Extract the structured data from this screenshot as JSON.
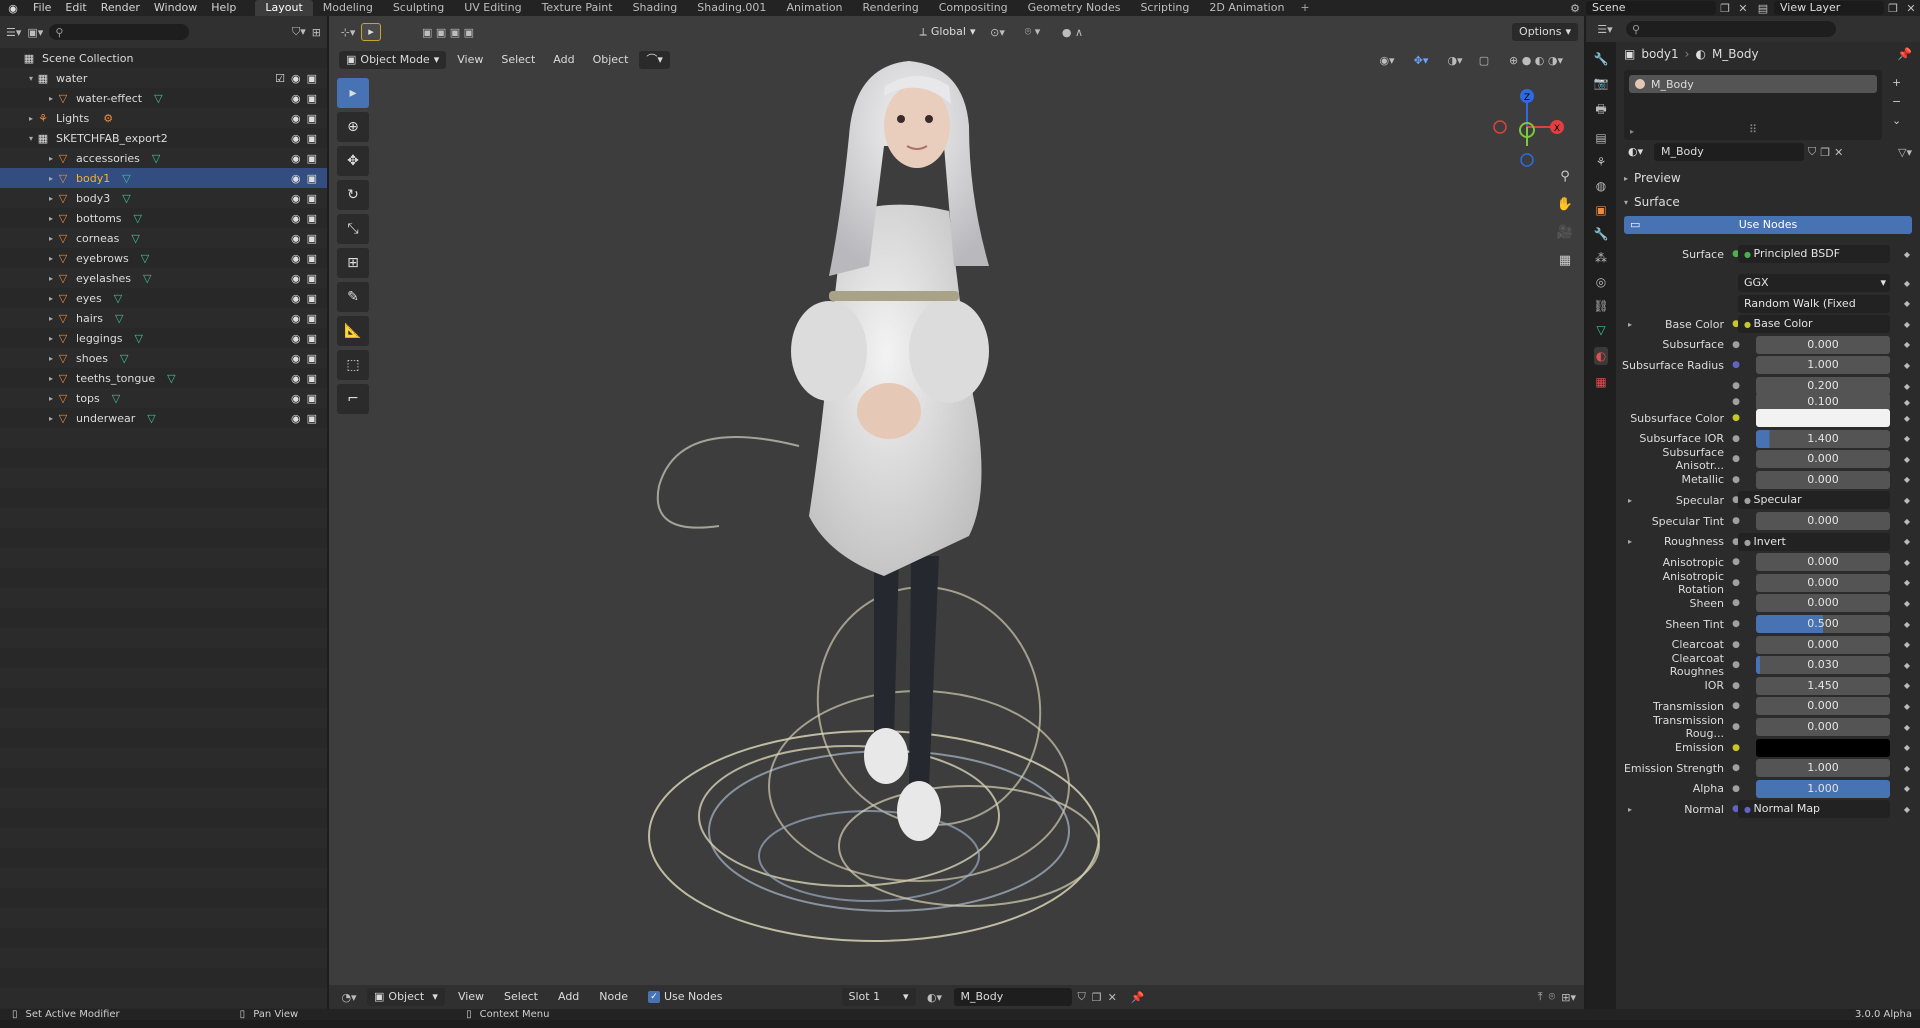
{
  "menu": [
    "File",
    "Edit",
    "Render",
    "Window",
    "Help"
  ],
  "workspaces": [
    "Layout",
    "Modeling",
    "Sculpting",
    "UV Editing",
    "Texture Paint",
    "Shading",
    "Shading.001",
    "Animation",
    "Rendering",
    "Compositing",
    "Geometry Nodes",
    "Scripting",
    "2D Animation"
  ],
  "active_workspace": "Layout",
  "scene_name": "Scene",
  "view_layer": "View Layer",
  "outliner": {
    "root": "Scene Collection",
    "rows": [
      {
        "label": "water",
        "indent": 1,
        "kind": "collection"
      },
      {
        "label": "water-effect",
        "indent": 2,
        "kind": "mesh"
      },
      {
        "label": "Lights",
        "indent": 1,
        "kind": "light"
      },
      {
        "label": "SKETCHFAB_export2",
        "indent": 1,
        "kind": "collection"
      },
      {
        "label": "accessories",
        "indent": 2,
        "kind": "mesh"
      },
      {
        "label": "body1",
        "indent": 2,
        "kind": "mesh",
        "selected": true
      },
      {
        "label": "body3",
        "indent": 2,
        "kind": "mesh"
      },
      {
        "label": "bottoms",
        "indent": 2,
        "kind": "mesh"
      },
      {
        "label": "corneas",
        "indent": 2,
        "kind": "mesh"
      },
      {
        "label": "eyebrows",
        "indent": 2,
        "kind": "mesh"
      },
      {
        "label": "eyelashes",
        "indent": 2,
        "kind": "mesh"
      },
      {
        "label": "eyes",
        "indent": 2,
        "kind": "mesh"
      },
      {
        "label": "hairs",
        "indent": 2,
        "kind": "mesh"
      },
      {
        "label": "leggings",
        "indent": 2,
        "kind": "mesh"
      },
      {
        "label": "shoes",
        "indent": 2,
        "kind": "mesh"
      },
      {
        "label": "teeths_tongue",
        "indent": 2,
        "kind": "mesh"
      },
      {
        "label": "tops",
        "indent": 2,
        "kind": "mesh"
      },
      {
        "label": "underwear",
        "indent": 2,
        "kind": "mesh"
      }
    ]
  },
  "viewport": {
    "mode": "Object Mode",
    "menus": [
      "View",
      "Select",
      "Add",
      "Object"
    ],
    "transform": "Global",
    "options": "Options",
    "axis": {
      "x": "X",
      "y": "Y",
      "z": "Z"
    }
  },
  "node_footer": {
    "mode": "Object",
    "menus": [
      "View",
      "Select",
      "Add",
      "Node"
    ],
    "use_nodes": "Use Nodes",
    "slot": "Slot 1",
    "material": "M_Body"
  },
  "properties": {
    "object": "body1",
    "material": "M_Body",
    "slot_item": "M_Body",
    "mat_field": "M_Body",
    "preview": "Preview",
    "surface_section": "Surface",
    "use_nodes": "Use Nodes",
    "rows": [
      {
        "label": "Surface",
        "value": "Principled BSDF",
        "kind": "link",
        "dot": "#4caf50"
      },
      {
        "label": "",
        "value": "GGX",
        "kind": "dd"
      },
      {
        "label": "",
        "value": "Random Walk (Fixed Radi...",
        "kind": "dd"
      },
      {
        "label": "Base Color",
        "value": "Base Color",
        "kind": "link",
        "dot": "#c7c729",
        "expand": true
      },
      {
        "label": "Subsurface",
        "value": "0.000",
        "kind": "num"
      },
      {
        "label": "Subsurface Radius",
        "value": "1.000",
        "kind": "num",
        "dot": "#6363c7"
      },
      {
        "label": "",
        "value": "0.200",
        "kind": "num"
      },
      {
        "label": "",
        "value": "0.100",
        "kind": "num"
      },
      {
        "label": "Subsurface Color",
        "value": "",
        "kind": "color",
        "dot": "#c7c729",
        "color": "#f2f2f2"
      },
      {
        "label": "Subsurface IOR",
        "value": "1.400",
        "kind": "num",
        "fill": 0.1
      },
      {
        "label": "Subsurface Anisotr...",
        "value": "0.000",
        "kind": "num"
      },
      {
        "label": "Metallic",
        "value": "0.000",
        "kind": "num"
      },
      {
        "label": "Specular",
        "value": "Specular",
        "kind": "link",
        "expand": true
      },
      {
        "label": "Specular Tint",
        "value": "0.000",
        "kind": "num"
      },
      {
        "label": "Roughness",
        "value": "Invert",
        "kind": "link",
        "expand": true
      },
      {
        "label": "Anisotropic",
        "value": "0.000",
        "kind": "num"
      },
      {
        "label": "Anisotropic Rotation",
        "value": "0.000",
        "kind": "num"
      },
      {
        "label": "Sheen",
        "value": "0.000",
        "kind": "num"
      },
      {
        "label": "Sheen Tint",
        "value": "0.500",
        "kind": "num",
        "fill": 0.5
      },
      {
        "label": "Clearcoat",
        "value": "0.000",
        "kind": "num"
      },
      {
        "label": "Clearcoat Roughnes",
        "value": "0.030",
        "kind": "num",
        "fill": 0.03
      },
      {
        "label": "IOR",
        "value": "1.450",
        "kind": "num"
      },
      {
        "label": "Transmission",
        "value": "0.000",
        "kind": "num"
      },
      {
        "label": "Transmission Roug...",
        "value": "0.000",
        "kind": "num"
      },
      {
        "label": "Emission",
        "value": "",
        "kind": "color",
        "dot": "#c7c729",
        "color": "#000000"
      },
      {
        "label": "Emission Strength",
        "value": "1.000",
        "kind": "num"
      },
      {
        "label": "Alpha",
        "value": "1.000",
        "kind": "num",
        "fill": 1.0
      },
      {
        "label": "Normal",
        "value": "Normal Map",
        "kind": "link",
        "dot": "#6363c7",
        "expand": true
      }
    ]
  },
  "status": {
    "left": "Set Active Modifier",
    "mid": "Pan View",
    "right_hint": "Context Menu",
    "version": "3.0.0 Alpha"
  },
  "colors": {
    "accent": "#4772b3",
    "selected_row": "#334d80",
    "selected_text": "#ffaf29",
    "mesh_icon": "#ee8b3c",
    "data_icon": "#39c79a"
  }
}
